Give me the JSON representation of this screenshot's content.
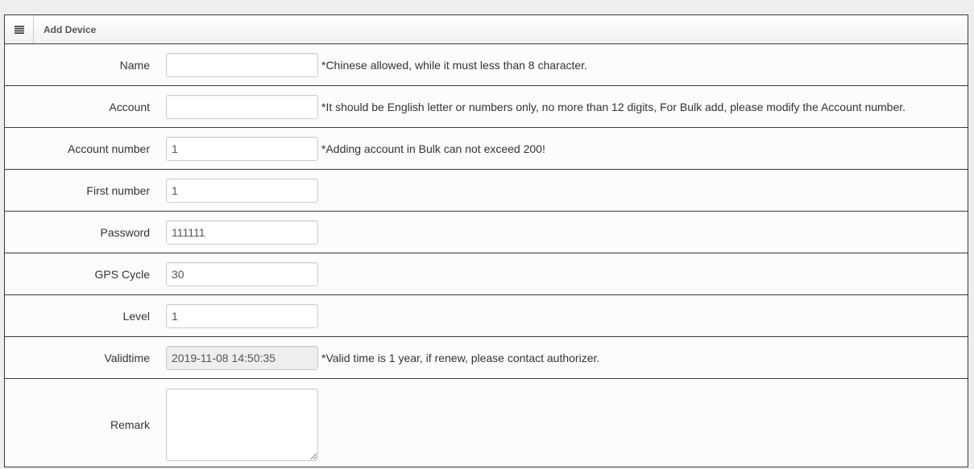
{
  "panel": {
    "title": "Add Device",
    "menu_icon": "list-icon"
  },
  "fields": {
    "name": {
      "label": "Name",
      "value": "",
      "hint": "*Chinese allowed, while it must less than 8 character."
    },
    "account": {
      "label": "Account",
      "value": "",
      "hint": "*It should be English letter or numbers only, no more than 12 digits, For Bulk add, please modify the Account number."
    },
    "account_number": {
      "label": "Account number",
      "value": "1",
      "hint": "*Adding account in Bulk can not exceed 200!"
    },
    "first_number": {
      "label": "First number",
      "value": "1"
    },
    "password": {
      "label": "Password",
      "value": "111111"
    },
    "gps_cycle": {
      "label": "GPS Cycle",
      "value": "30"
    },
    "level": {
      "label": "Level",
      "value": "1"
    },
    "validtime": {
      "label": "Validtime",
      "value": "2019-11-08 14:50:35",
      "hint": "*Valid time is 1 year, if renew, please contact authorizer."
    },
    "remark": {
      "label": "Remark",
      "value": ""
    }
  },
  "colors": {
    "border": "#3a3a3a",
    "disabled_bg": "#eeeeee",
    "text": "#333333"
  }
}
